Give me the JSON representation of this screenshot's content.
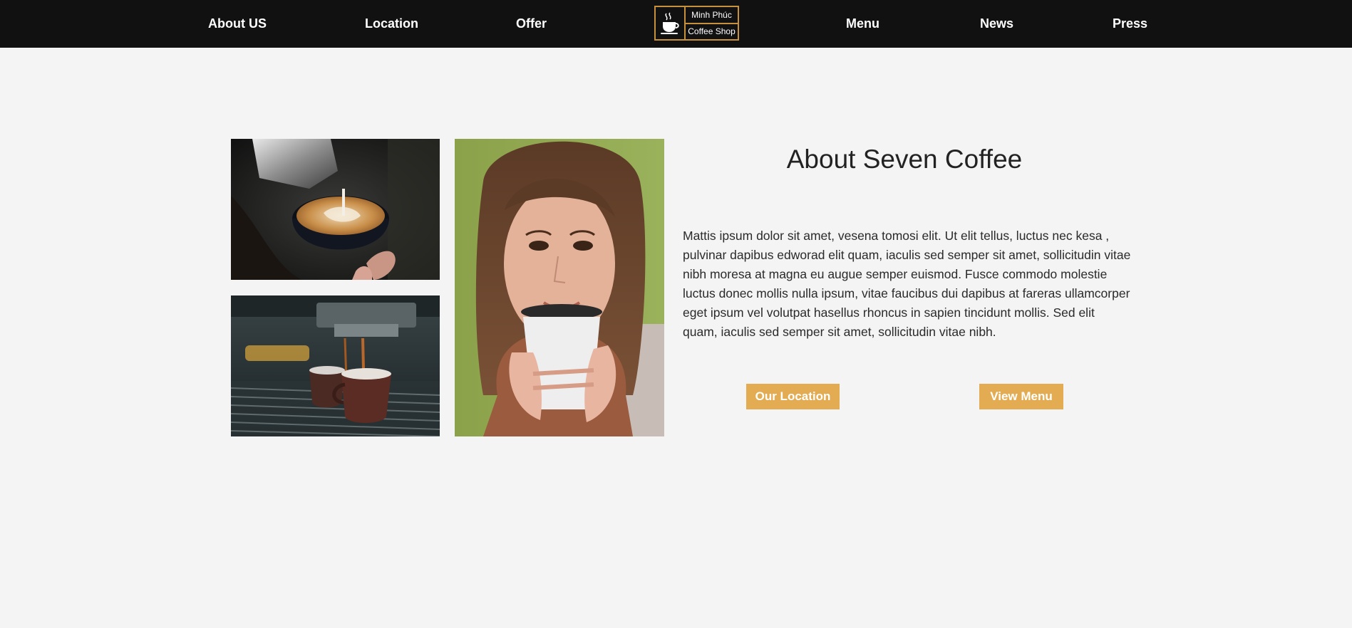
{
  "nav": {
    "left": [
      "About US",
      "Location",
      "Offer"
    ],
    "right": [
      "Menu",
      "News",
      "Press"
    ]
  },
  "logo": {
    "line1": "Minh Phúc",
    "line2": "Coffee Shop",
    "icon": "coffee-cup-icon",
    "border_color": "#c7913c"
  },
  "images": {
    "latte": "latte-art-photo",
    "espresso": "espresso-machine-photo",
    "woman": "woman-with-coffee-photo"
  },
  "about": {
    "title": "About Seven Coffee",
    "body": "Mattis ipsum dolor sit amet, vesena tomosi elit. Ut elit tellus, luctus nec kesa , pulvinar dapibus edworad elit quam, iaculis sed semper sit amet, sollicitudin vitae nibh moresa at magna eu augue semper euismod. Fusce commodo molestie luctus donec mollis nulla ipsum, vitae faucibus dui dapibus at fareras ullamcorper eget ipsum vel volutpat hasellus rhoncus in sapien tincidunt mollis. Sed elit quam, iaculis sed semper sit amet, sollicitudin vitae nibh.",
    "buttons": {
      "location": "Our Location",
      "menu": "View Menu"
    }
  },
  "colors": {
    "header_bg": "#111111",
    "page_bg": "#f4f4f4",
    "accent": "#e3ac52"
  }
}
